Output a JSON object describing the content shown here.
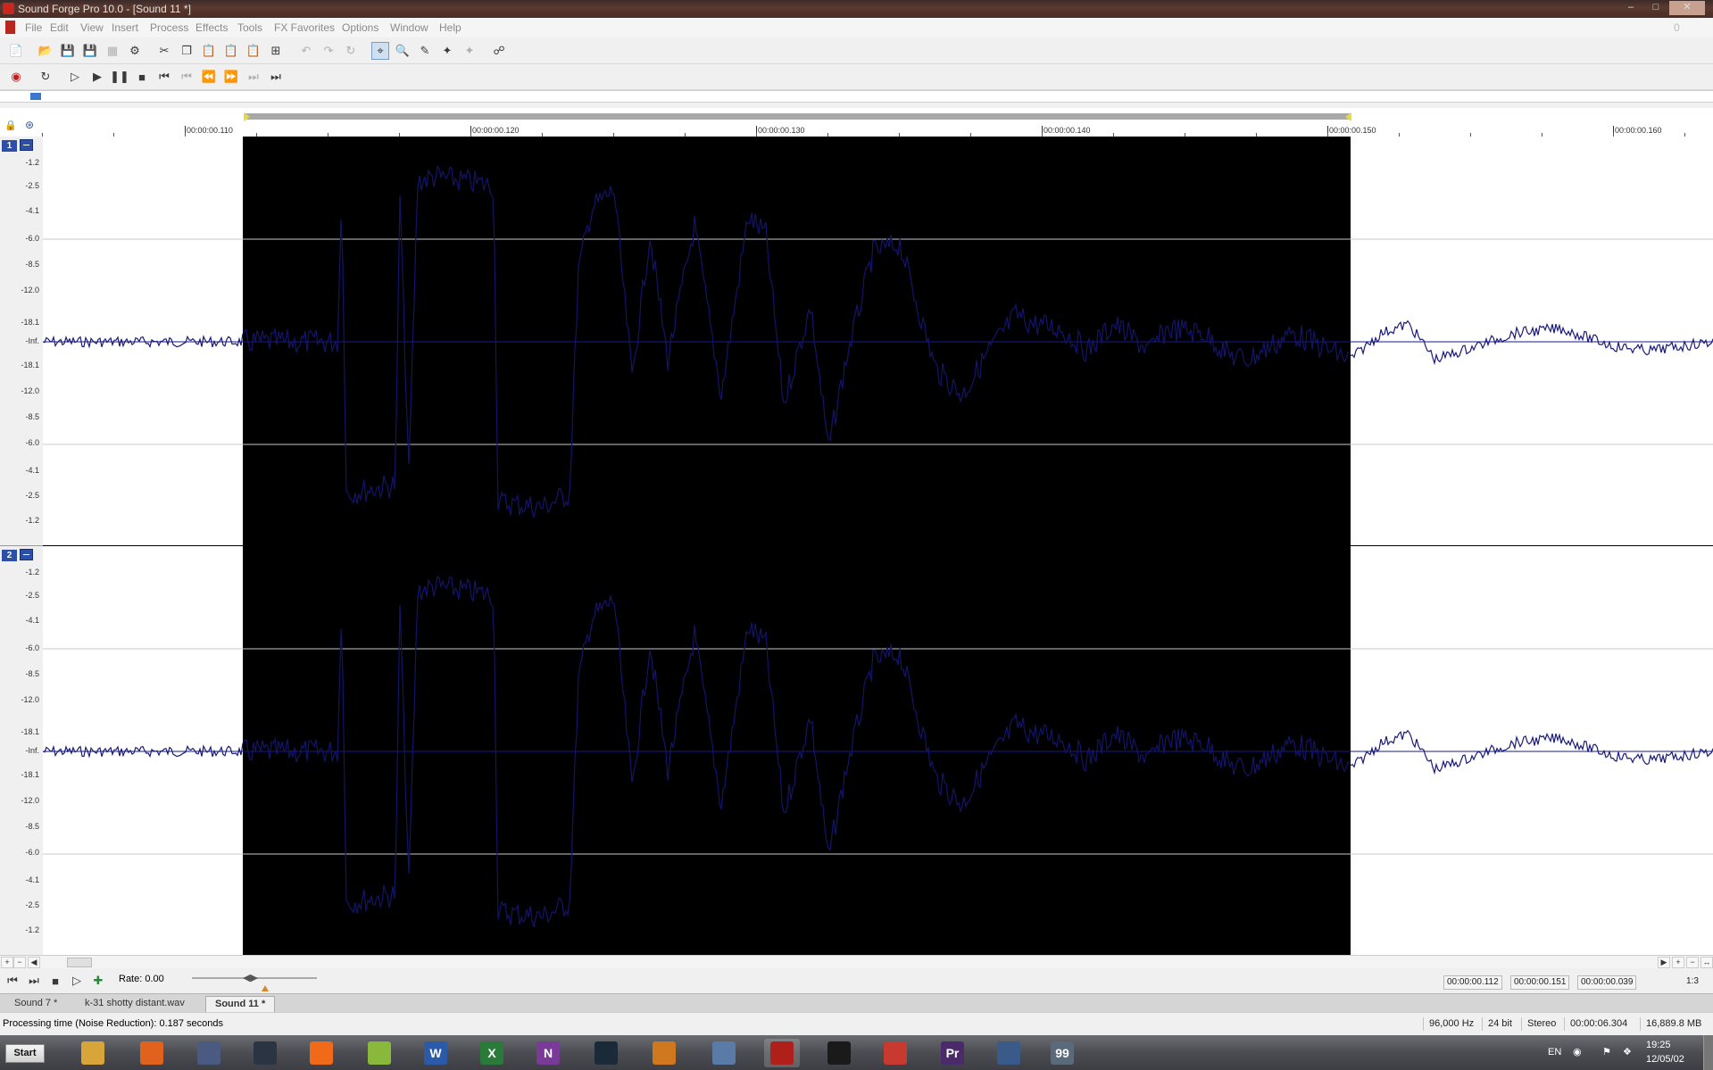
{
  "window": {
    "title": "Sound Forge Pro 10.0 - [Sound 11 *]",
    "right_indicator": "0"
  },
  "menu": {
    "items": [
      "File",
      "Edit",
      "View",
      "Insert",
      "Process",
      "Effects",
      "Tools",
      "FX Favorites",
      "Options",
      "Window",
      "Help"
    ]
  },
  "toolbar1": {
    "icons": [
      "new-icon",
      "open-icon",
      "save-icon",
      "save-as-icon",
      "render-icon",
      "properties-icon",
      "cut-icon",
      "copy-icon",
      "paste-icon",
      "paste-special-icon",
      "mix-icon",
      "trim-icon",
      "undo-icon",
      "redo-icon",
      "repeat-icon",
      "edit-tool-icon",
      "magnify-tool-icon",
      "pencil-tool-icon",
      "envelope-tool-icon",
      "event-tool-icon",
      "loop-icon"
    ]
  },
  "toolbar2": {
    "icons": [
      "record-icon",
      "loop-playback-icon",
      "play-all-icon",
      "play-icon",
      "pause-icon",
      "stop-icon",
      "go-to-start-icon",
      "previous-marker-icon",
      "rewind-icon",
      "forward-icon",
      "next-marker-icon",
      "go-to-end-icon"
    ]
  },
  "ruler": {
    "labels": [
      "00:00:00.110",
      "00:00:00.120",
      "00:00:00.130",
      "00:00:00.140",
      "00:00:00.150",
      "00:00:00.160"
    ]
  },
  "channels": [
    {
      "number": "1",
      "db_labels": [
        "-1.2",
        "-2.5",
        "-4.1",
        "-6.0",
        "-8.5",
        "-12.0",
        "-18.1",
        "-Inf.",
        "-18.1",
        "-12.0",
        "-8.5",
        "-6.0",
        "-4.1",
        "-2.5",
        "-1.2"
      ]
    },
    {
      "number": "2",
      "db_labels": [
        "-1.2",
        "-2.5",
        "-4.1",
        "-6.0",
        "-8.5",
        "-12.0",
        "-18.1",
        "-Inf.",
        "-18.1",
        "-12.0",
        "-8.5",
        "-6.0",
        "-4.1",
        "-2.5",
        "-1.2"
      ]
    }
  ],
  "transport": {
    "rate_label": "Rate: 0.00",
    "selection_start": "00:00:00.112",
    "selection_end": "00:00:00.151",
    "selection_length": "00:00:00.039",
    "zoom_ratio": "1:3"
  },
  "tabs": [
    "Sound 7 *",
    "k-31 shotty distant.wav",
    "Sound 11 *"
  ],
  "active_tab": "Sound 11 *",
  "status": {
    "message": "Processing time (Noise Reduction): 0.187 seconds",
    "sample_rate": "96,000 Hz",
    "bit_depth": "24 bit",
    "channels": "Stereo",
    "length": "00:00:06.304",
    "free_space": "16,889.8 MB"
  },
  "taskbar": {
    "start_label": "Start",
    "language": "EN",
    "time": "19:25",
    "date": "12/05/02",
    "apps": [
      {
        "name": "file-explorer-icon",
        "color": "#d8a53a",
        "glyph": ""
      },
      {
        "name": "firefox-icon",
        "color": "#e0621c",
        "glyph": ""
      },
      {
        "name": "stopwatch-app-icon",
        "color": "#4a5a80",
        "glyph": ""
      },
      {
        "name": "steam-icon",
        "color": "#2a3442",
        "glyph": ""
      },
      {
        "name": "origin-icon",
        "color": "#f06a1a",
        "glyph": ""
      },
      {
        "name": "notepad-plus-icon",
        "color": "#8ab83a",
        "glyph": ""
      },
      {
        "name": "word-icon",
        "color": "#2b5aa8",
        "glyph": "W"
      },
      {
        "name": "excel-icon",
        "color": "#2a7a3a",
        "glyph": "X"
      },
      {
        "name": "onenote-icon",
        "color": "#7a3a98",
        "glyph": "N"
      },
      {
        "name": "molecule-app-icon",
        "color": "#1a2a38",
        "glyph": ""
      },
      {
        "name": "reason-app-icon",
        "color": "#d07820",
        "glyph": ""
      },
      {
        "name": "recycle-app-icon",
        "color": "#5a7aa8",
        "glyph": ""
      },
      {
        "name": "sound-forge-icon",
        "color": "#b0201a",
        "glyph": ""
      },
      {
        "name": "headphones-icon",
        "color": "#1a1a1a",
        "glyph": ""
      },
      {
        "name": "wireframe-app-icon",
        "color": "#c83a30",
        "glyph": ""
      },
      {
        "name": "premiere-icon",
        "color": "#4a2a6a",
        "glyph": "Pr"
      },
      {
        "name": "control-panel-icon",
        "color": "#3a5a8a",
        "glyph": ""
      },
      {
        "name": "monitor-app-icon",
        "color": "#5a6a7a",
        "glyph": "99"
      }
    ]
  }
}
